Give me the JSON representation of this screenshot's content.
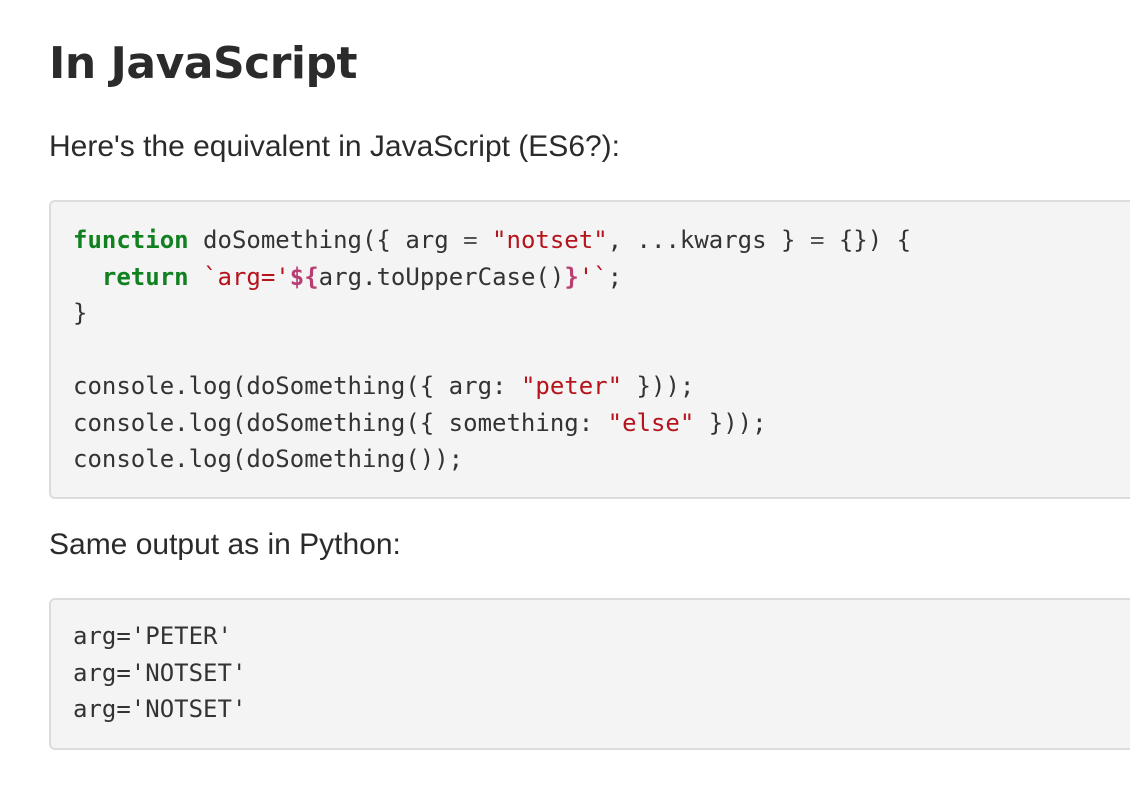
{
  "heading": "In JavaScript",
  "intro_text": "Here's the equivalent in JavaScript (ES6?):",
  "js_code": {
    "l1": {
      "kw": "function",
      "a": " doSomething({ arg ",
      "eq": "=",
      "b": " ",
      "s": "\"notset\"",
      "c": ", ...kwargs } ",
      "eq2": "=",
      "d": " {}) {"
    },
    "l2": {
      "indent": "  ",
      "kw": "return",
      "sp": " ",
      "t1": "`arg='",
      "i1": "${",
      "mid": "arg.toUpperCase()",
      "i2": "}",
      "t2": "'`",
      "end": ";"
    },
    "l3": "}",
    "l5": {
      "a": "console.log(doSomething({ arg: ",
      "s": "\"peter\"",
      "b": " }));"
    },
    "l6": {
      "a": "console.log(doSomething({ something: ",
      "s": "\"else\"",
      "b": " }));"
    },
    "l7": "console.log(doSomething());"
  },
  "outro_text": "Same output as in Python:",
  "output_lines": [
    "arg='PETER'",
    "arg='NOTSET'",
    "arg='NOTSET'"
  ],
  "colors": {
    "keyword": "#11811f",
    "string": "#b5141c",
    "interpolation": "#b83f73",
    "code_background": "#f4f4f4"
  }
}
